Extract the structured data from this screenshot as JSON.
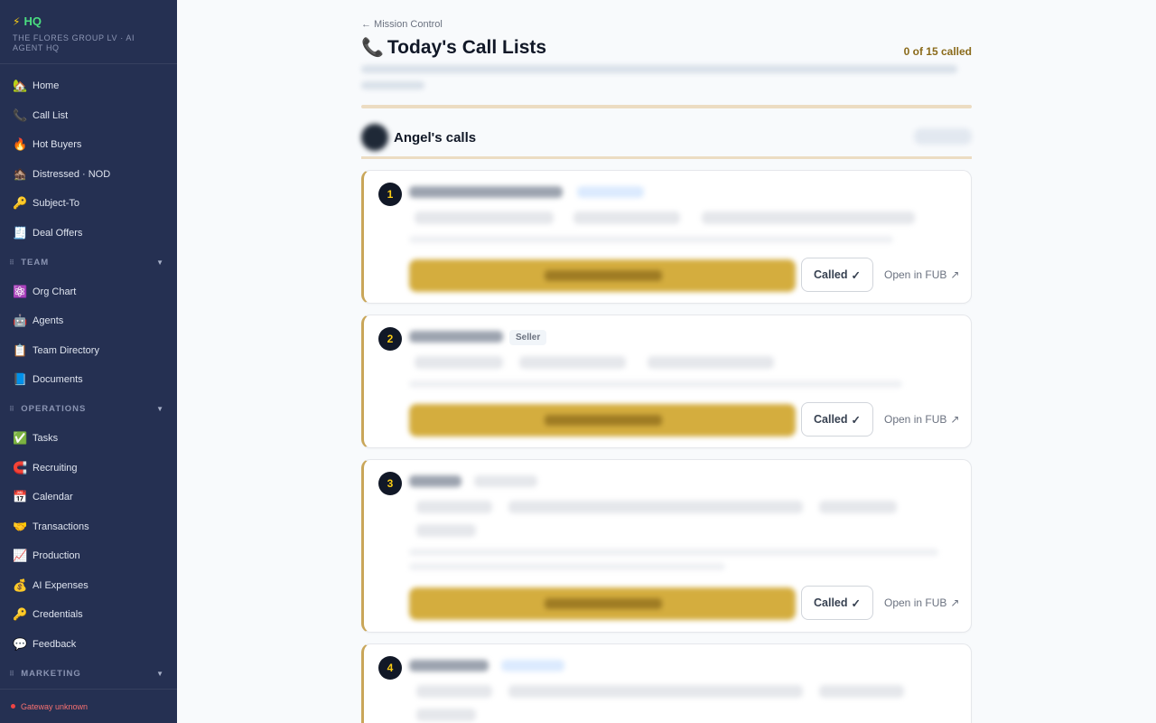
{
  "sidebar": {
    "brand": {
      "icon": "⚡",
      "title": "HQ",
      "subtitle": "THE FLORES GROUP LV · AI AGENT HQ"
    },
    "items_top": [
      {
        "icon": "🏡",
        "label": "Home"
      },
      {
        "icon": "📞",
        "label": "Call List"
      },
      {
        "icon": "🔥",
        "label": "Hot Buyers"
      },
      {
        "icon": "🏚️",
        "label": "Distressed · NOD"
      },
      {
        "icon": "🔑",
        "label": "Subject-To"
      },
      {
        "icon": "🧾",
        "label": "Deal Offers"
      }
    ],
    "section_team": {
      "label": "TEAM",
      "grip": "⠿",
      "caret": "▼"
    },
    "items_team": [
      {
        "icon": "⚛️",
        "label": "Org Chart"
      },
      {
        "icon": "🤖",
        "label": "Agents"
      },
      {
        "icon": "📋",
        "label": "Team Directory"
      },
      {
        "icon": "📘",
        "label": "Documents"
      }
    ],
    "section_ops": {
      "label": "OPERATIONS",
      "grip": "⠿",
      "caret": "▼"
    },
    "items_ops": [
      {
        "icon": "✅",
        "label": "Tasks"
      },
      {
        "icon": "🧲",
        "label": "Recruiting"
      },
      {
        "icon": "📅",
        "label": "Calendar"
      },
      {
        "icon": "🤝",
        "label": "Transactions"
      },
      {
        "icon": "📈",
        "label": "Production"
      },
      {
        "icon": "💰",
        "label": "AI Expenses"
      },
      {
        "icon": "🔑",
        "label": "Credentials"
      },
      {
        "icon": "💬",
        "label": "Feedback"
      }
    ],
    "section_marketing": {
      "label": "MARKETING",
      "grip": "⠿",
      "caret": "▼"
    },
    "gateway": "Gateway unknown"
  },
  "header": {
    "back": "← Mission Control",
    "title_icon": "📞",
    "title": "Today's Call Lists",
    "count": "0 of 15 called"
  },
  "person": {
    "name": "Angel's calls"
  },
  "cards": [
    {
      "num": "1",
      "called": "Called",
      "check": "✓",
      "fub": "Open in FUB",
      "fub_icon": "↗"
    },
    {
      "num": "2",
      "badge": "Seller",
      "called": "Called",
      "check": "✓",
      "fub": "Open in FUB",
      "fub_icon": "↗"
    },
    {
      "num": "3",
      "called": "Called",
      "check": "✓",
      "fub": "Open in FUB",
      "fub_icon": "↗"
    },
    {
      "num": "4"
    }
  ],
  "colors": {
    "sidebar_bg": "#253052",
    "accent_gold": "#c9a659",
    "brand_green": "#4ade80",
    "gateway_red": "#f87171"
  }
}
